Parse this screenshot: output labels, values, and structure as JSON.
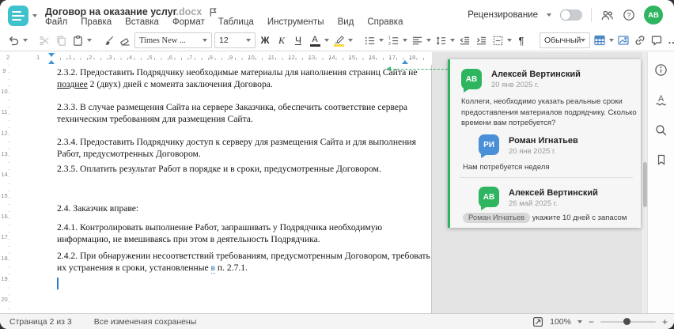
{
  "colors": {
    "brand_teal": "#3fc2cd",
    "avatar_green": "#2fb560",
    "avatar_blue": "#4a90d9",
    "comment_accent_green": "#2fb55e",
    "highlight_yellow": "#fbd83c",
    "toolbar_icon_blue": "#4a86c5"
  },
  "header": {
    "title": "Договор на оказание услуг",
    "title_ext": ".docx",
    "menu_items": [
      "Файл",
      "Правка",
      "Вставка",
      "Формат",
      "Таблица",
      "Инструменты",
      "Вид",
      "Справка"
    ],
    "review_label": "Рецензирование",
    "avatar_initials": "АВ"
  },
  "toolbar": {
    "font_name": "Times New ...",
    "font_size": "12",
    "bold_label": "Ж",
    "italic_label": "К",
    "underline_label": "Ч",
    "font_color_label": "А",
    "pilcrow": "¶",
    "style_name": "Обычный",
    "more_label": "..."
  },
  "ruler": {
    "left_numbers": [
      "2",
      "1"
    ],
    "numbers": [
      "1",
      "2",
      "3",
      "4",
      "5",
      "6",
      "7",
      "8",
      "9",
      "10",
      "11",
      "12",
      "13",
      "14",
      "15",
      "16",
      "17",
      "18"
    ],
    "vertical_numbers": [
      "9",
      "10",
      "11",
      "12",
      "13",
      "14",
      "15",
      "16",
      "17",
      "18",
      "19",
      "20"
    ]
  },
  "document": {
    "p232_l1": "2.3.2. Предоставить Подрядчику необходимые материалы для наполнения страниц Сайта не",
    "p232_l2_u": "позднее",
    "p232_l2_rest": " 2 (двух) дней с момента заключения Договора.",
    "p233_l1": "2.3.3. В случае размещения Сайта на сервере Заказчика, обеспечить соответствие сервера",
    "p233_l2": "техническим требованиям для размещения Сайта.",
    "p234_l1": "2.3.4. Предоставить Подрядчику доступ к серверу для размещения Сайта и для выполнения",
    "p234_l2": "Работ, предусмотренных Договором.",
    "p235": "2.3.5. Оплатить результат Работ в порядке и в сроки, предусмотренные Договором.",
    "p24": "2.4. Заказчик вправе:",
    "p241_l1": "2.4.1. Контролировать выполнение Работ, запрашивать у Подрядчика необходимую",
    "p241_l2": "информацию, не вмешиваясь при этом в деятельность Подрядчика.",
    "p242_l1": "2.4.2. При обнаружении несоответствий требованиям, предусмотренным Договором, требовать",
    "p242_l2_pre": "их устранения в сроки, установленные ",
    "p242_l2_mark": "в",
    "p242_l2_post": " п. 2.7.1."
  },
  "comments": {
    "thread": {
      "initials": "АВ",
      "author": "Алексей Вертинский",
      "date": "20 янв 2025 г.",
      "text": "Коллеги, необходимо указать реальные сроки предоставления материалов подрядчику. Сколько времени вам потребуется?"
    },
    "reply1": {
      "initials": "РИ",
      "author": "Роман Игнатьев",
      "date": "20 янв 2025 г.",
      "text": "Нам потребуется неделя"
    },
    "reply2": {
      "initials": "АВ",
      "author": "Алексей Вертинский",
      "date": "26 май 2025 г.",
      "mention": "Роман Игнатьев",
      "text": " укажите 10 дней с запасом"
    }
  },
  "statusbar": {
    "page_info": "Страница 2 из 3",
    "saved_status": "Все изменения сохранены",
    "zoom_value": "100%"
  }
}
